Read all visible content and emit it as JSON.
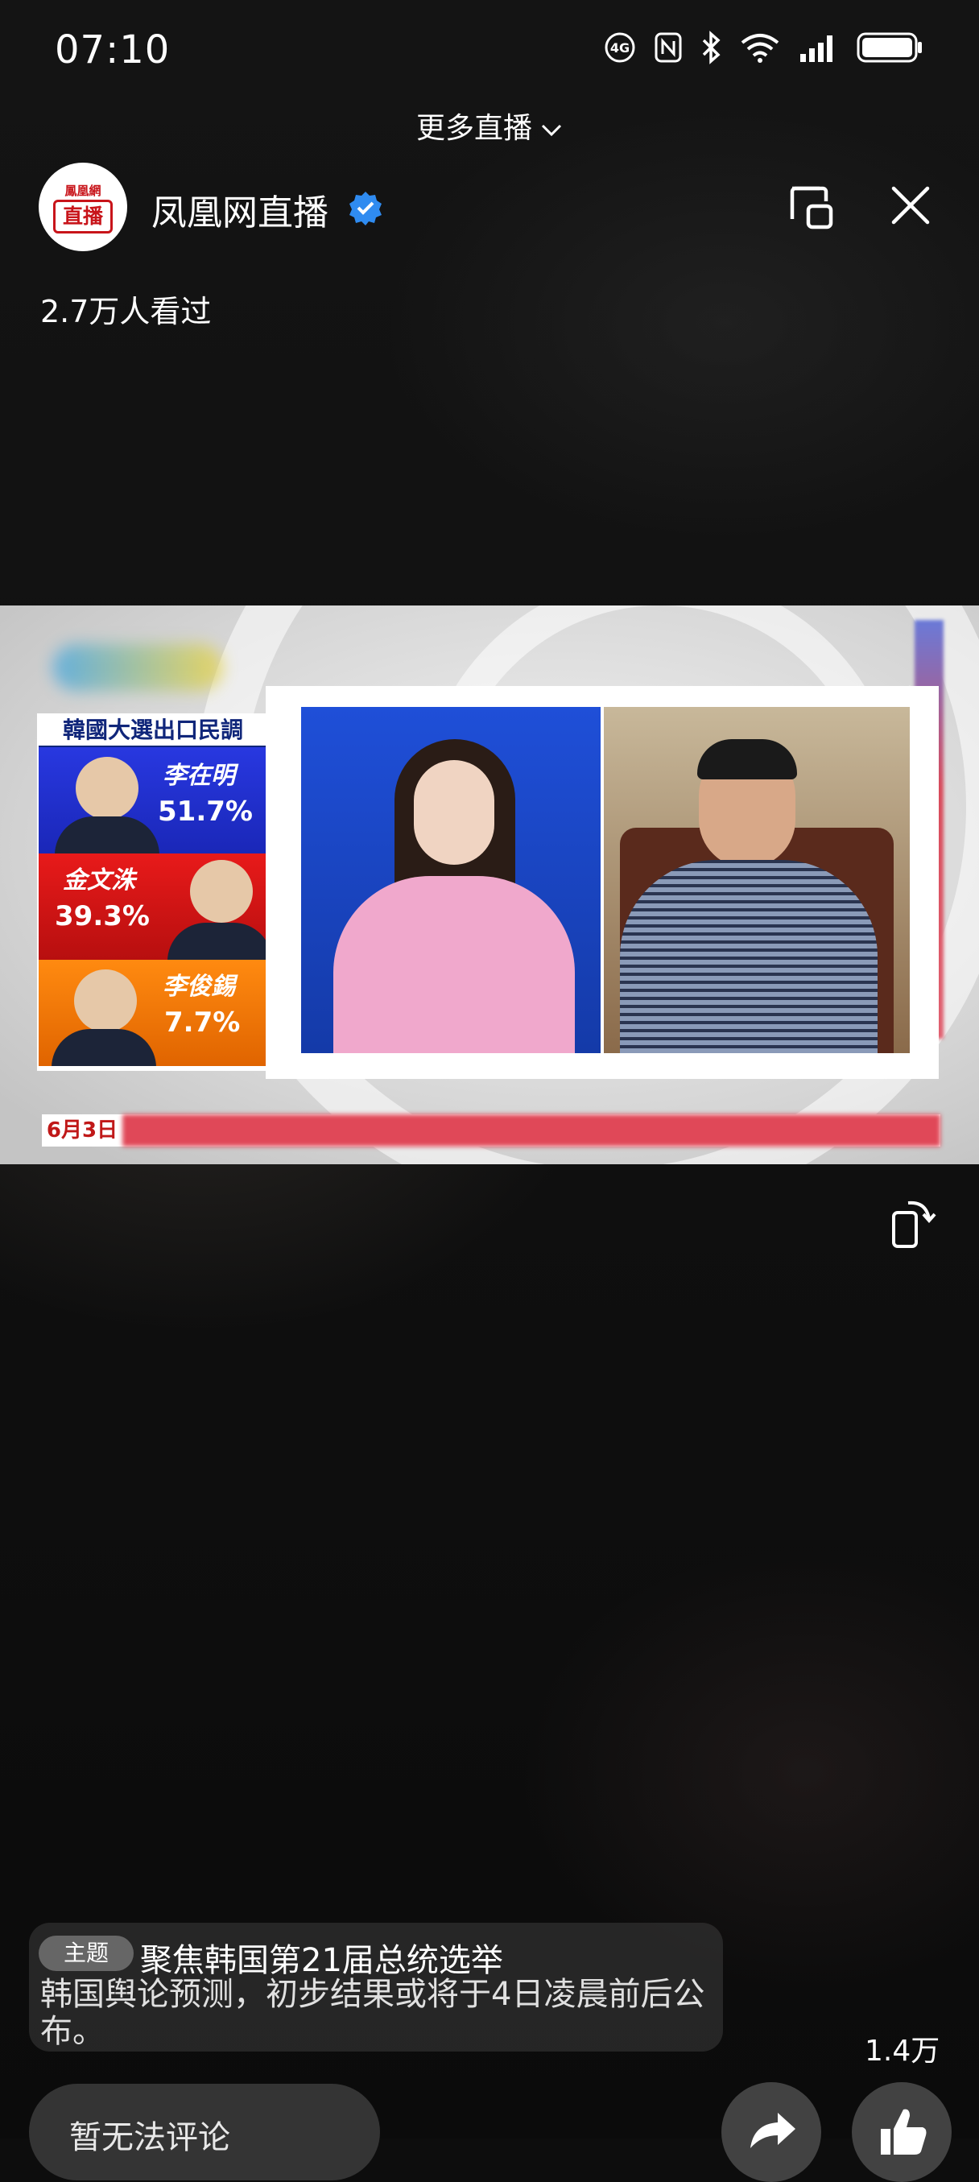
{
  "status_bar": {
    "time": "07:10"
  },
  "header": {
    "more_live_label": "更多直播",
    "channel_name": "凤凰网直播",
    "avatar_top_text": "鳳凰網",
    "avatar_box_text": "直播",
    "viewers": "2.7万人看过"
  },
  "video": {
    "poll_title": "韓國大選出口民調",
    "candidates": [
      {
        "name": "李在明",
        "percent": "51.7%",
        "color": "#2a38d8"
      },
      {
        "name": "金文洙",
        "percent": "39.3%",
        "color": "#e01414"
      },
      {
        "name": "李俊錫",
        "percent": "7.7%",
        "color": "#f57c0a"
      }
    ],
    "watermark": "凤直播",
    "ticker_date": "6月3日"
  },
  "topic": {
    "badge": "主题",
    "title": "聚焦韩国第21届总统选举",
    "description": "韩国舆论预测，初步结果或将于4日凌晨前后公布。"
  },
  "engagement": {
    "like_count": "1.4万"
  },
  "comment": {
    "placeholder": "暂无法评论"
  },
  "icons": [
    "nfc-icon",
    "bluetooth-icon",
    "wifi-icon",
    "signal-icon",
    "battery-icon",
    "verified-icon",
    "pip-icon",
    "close-icon",
    "rotate-icon",
    "share-icon",
    "like-icon"
  ]
}
